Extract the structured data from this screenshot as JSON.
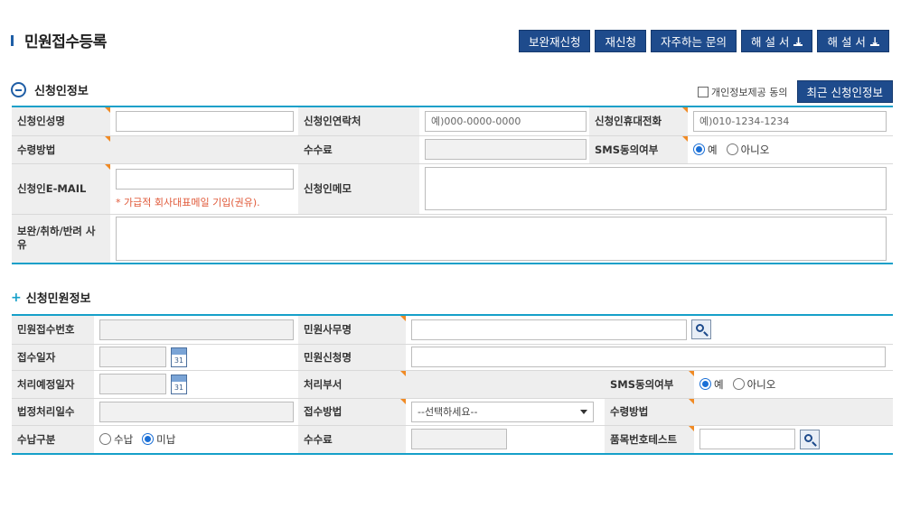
{
  "page": {
    "title": "민원접수등록"
  },
  "top_buttons": {
    "supplement": "보완재신청",
    "reapply": "재신청",
    "faq": "자주하는 문의",
    "manual1": "해 설 서",
    "manual2": "해 설 서"
  },
  "applicant": {
    "section_title": "신청인정보",
    "consent_label": "개인정보제공 동의",
    "recent_button": "최근 신청인정보",
    "name_label": "신청인성명",
    "name_value": "",
    "contact_label": "신청인연락처",
    "contact_placeholder": "예)000-0000-0000",
    "mobile_label": "신청인휴대전화",
    "mobile_placeholder": "예)010-1234-1234",
    "receive_label": "수령방법",
    "fee_label": "수수료",
    "sms_label": "SMS동의여부",
    "sms_yes": "예",
    "sms_no": "아니오",
    "email_label": "신청인E-MAIL",
    "email_hint": "* 가급적 회사대표메일 기입(권유).",
    "memo_label": "신청인메모",
    "reason_label": "보완/취하/반려 사유"
  },
  "petition": {
    "section_title": "신청민원정보",
    "receipt_no_label": "민원접수번호",
    "office_label": "민원사무명",
    "receipt_date_label": "접수일자",
    "petition_name_label": "민원신청명",
    "due_date_label": "처리예정일자",
    "dept_label": "처리부서",
    "sms_label": "SMS동의여부",
    "sms_yes": "예",
    "sms_no": "아니오",
    "legal_days_label": "법정처리일수",
    "method_label": "접수방법",
    "method_selected": "--선택하세요--",
    "receive_label": "수령방법",
    "payment_label": "수납구분",
    "paid": "수납",
    "unpaid": "미납",
    "fee_label": "수수료",
    "item_no_label": "품목번호테스트",
    "calendar_day": "31"
  },
  "colors": {
    "navy": "#1e4b8c",
    "accent": "#16a0c9",
    "required": "#f08a24",
    "hint": "#e05a3a"
  }
}
